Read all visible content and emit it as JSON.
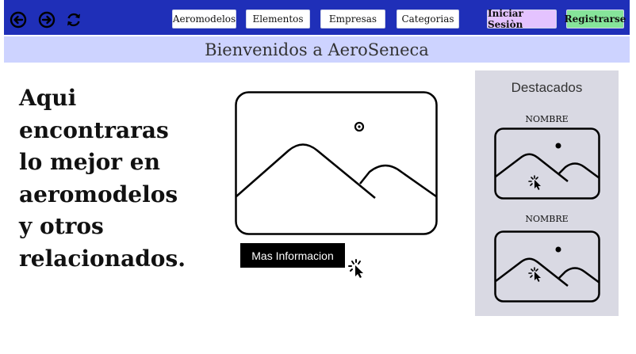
{
  "nav": {
    "back": "back-icon",
    "forward": "forward-icon",
    "reload": "reload-icon",
    "menu": [
      "Aeromodelos",
      "Elementos",
      "Empresas",
      "Categorias"
    ],
    "login": "Iniciar Sesiòn",
    "register": "Registrarse"
  },
  "welcome": "Bienvenidos a AeroSeneca",
  "hero": {
    "lines": [
      "Aqui",
      "encontraras",
      "lo mejor en",
      "aeromodelos",
      "y otros",
      "relacionados."
    ],
    "button": "Mas Informacion"
  },
  "featured": {
    "title": "Destacados",
    "cards": [
      {
        "label": "NOMBRE"
      },
      {
        "label": "NOMBRE"
      }
    ]
  },
  "colors": {
    "topbar": "#1f2fb8",
    "welcome_bar": "#cdd3ff",
    "login": "#e4c3ff",
    "register": "#86e49a",
    "panel": "#d9d9e3"
  }
}
